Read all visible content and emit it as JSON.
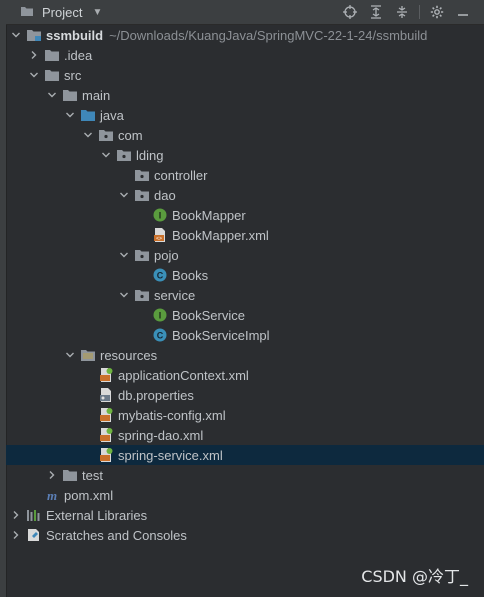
{
  "header": {
    "title": "Project",
    "tool_icons": [
      "crosshair-icon",
      "expand-icon",
      "collapse-icon",
      "gear-icon",
      "hide-icon"
    ]
  },
  "tree": [
    {
      "label": "ssmbuild",
      "path": "~/Downloads/KuangJava/SpringMVC-22-1-24/ssmbuild",
      "icon": "module-folder",
      "depth": 0,
      "expanded": true,
      "bold": true
    },
    {
      "label": ".idea",
      "icon": "folder",
      "depth": 1,
      "expanded": false
    },
    {
      "label": "src",
      "icon": "folder",
      "depth": 1,
      "expanded": true
    },
    {
      "label": "main",
      "icon": "folder",
      "depth": 2,
      "expanded": true
    },
    {
      "label": "java",
      "icon": "source-folder",
      "depth": 3,
      "expanded": true
    },
    {
      "label": "com",
      "icon": "package",
      "depth": 4,
      "expanded": true
    },
    {
      "label": "lding",
      "icon": "package",
      "depth": 5,
      "expanded": true
    },
    {
      "label": "controller",
      "icon": "package",
      "depth": 6,
      "leaf": true
    },
    {
      "label": "dao",
      "icon": "package",
      "depth": 6,
      "expanded": true
    },
    {
      "label": "BookMapper",
      "icon": "interface",
      "depth": 7,
      "leaf": true
    },
    {
      "label": "BookMapper.xml",
      "icon": "xml",
      "depth": 7,
      "leaf": true
    },
    {
      "label": "pojo",
      "icon": "package",
      "depth": 6,
      "expanded": true
    },
    {
      "label": "Books",
      "icon": "class",
      "depth": 7,
      "leaf": true
    },
    {
      "label": "service",
      "icon": "package",
      "depth": 6,
      "expanded": true
    },
    {
      "label": "BookService",
      "icon": "interface",
      "depth": 7,
      "leaf": true
    },
    {
      "label": "BookServiceImpl",
      "icon": "class",
      "depth": 7,
      "leaf": true
    },
    {
      "label": "resources",
      "icon": "resources-folder",
      "depth": 3,
      "expanded": true
    },
    {
      "label": "applicationContext.xml",
      "icon": "spring-xml",
      "depth": 4,
      "leaf": true
    },
    {
      "label": "db.properties",
      "icon": "properties",
      "depth": 4,
      "leaf": true
    },
    {
      "label": "mybatis-config.xml",
      "icon": "spring-xml",
      "depth": 4,
      "leaf": true
    },
    {
      "label": "spring-dao.xml",
      "icon": "spring-xml",
      "depth": 4,
      "leaf": true
    },
    {
      "label": "spring-service.xml",
      "icon": "spring-xml",
      "depth": 4,
      "leaf": true,
      "selected": true
    },
    {
      "label": "test",
      "icon": "folder",
      "depth": 2,
      "expanded": false
    },
    {
      "label": "pom.xml",
      "icon": "maven",
      "depth": 1,
      "leaf": true
    },
    {
      "label": "External Libraries",
      "icon": "libraries",
      "depth": 0,
      "expanded": false
    },
    {
      "label": "Scratches and Consoles",
      "icon": "scratches",
      "depth": 0,
      "expanded": false
    }
  ],
  "watermark": "CSDN @冷丁_",
  "colors": {
    "background": "#2b2d30",
    "header": "#3c3f41",
    "selection": "#0d293e",
    "folder": "#8f959c",
    "source_folder": "#3f87b8",
    "class": "#3a8fb7",
    "interface": "#5a9b3e",
    "xml": "#c9702a"
  }
}
